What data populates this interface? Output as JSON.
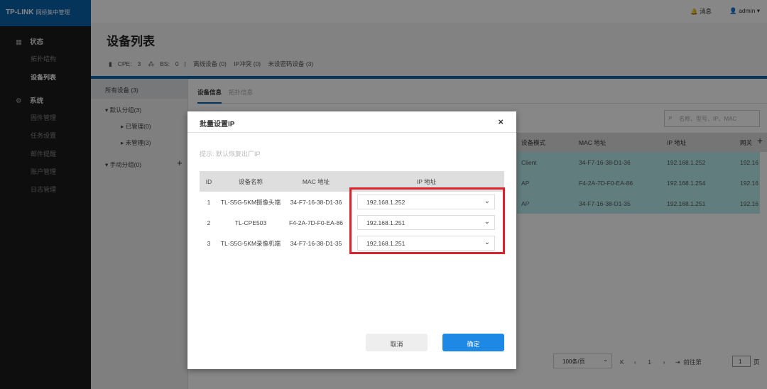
{
  "brand": {
    "logo": "TP-LINK",
    "product": "网桥集中管理"
  },
  "topbar": {
    "messages": "消息",
    "user": "admin"
  },
  "sidebar": {
    "sections": [
      {
        "label": "状态",
        "items": [
          "拓扑结构",
          "设备列表"
        ]
      },
      {
        "label": "系统",
        "items": [
          "固件管理",
          "任务设置",
          "邮件提醒",
          "账户管理",
          "日志管理"
        ]
      }
    ],
    "active": "设备列表"
  },
  "page": {
    "title": "设备列表",
    "stats": {
      "cpe_label": "CPE:",
      "cpe": "3",
      "bs_label": "BS:",
      "bs": "0",
      "offline": "离线设备 (0)",
      "ipconflict": "IP冲突 (0)",
      "nopassword": "未设密码设备 (3)"
    }
  },
  "groups": {
    "all": "所有设备 (3)",
    "default": "默认分组(3)",
    "managed": "已管理(0)",
    "unmanaged": "未管理(3)",
    "manual": "手动分组(0)"
  },
  "tabs": [
    "设备信息",
    "拓扑信息"
  ],
  "search": {
    "placeholder": "名称、型号、IP、MAC"
  },
  "bg_table": {
    "headers": [
      "设备模式",
      "MAC 地址",
      "IP 地址",
      "网关"
    ],
    "rows": [
      [
        "Client",
        "34-F7-16-38-D1-36",
        "192.168.1.252",
        "192.16"
      ],
      [
        "AP",
        "F4-2A-7D-F0-EA-86",
        "192.168.1.254",
        "192.16"
      ],
      [
        "AP",
        "34-F7-16-38-D1-35",
        "192.168.1.251",
        "192.16"
      ]
    ]
  },
  "pager": {
    "page_size": "100条/页",
    "current": "1",
    "goto_label": "前往第",
    "goto_value": "1",
    "page_suffix": "页"
  },
  "modal": {
    "title": "批量设置IP",
    "hint": "提示: 默认恢复出厂IP",
    "headers": [
      "ID",
      "设备名称",
      "MAC 地址",
      "IP 地址"
    ],
    "rows": [
      {
        "id": "1",
        "name": "TL-S5G-5KM摄像头端",
        "mac": "34-F7-16-38-D1-36",
        "ip": "192.168.1.252"
      },
      {
        "id": "2",
        "name": "TL-CPE503",
        "mac": "F4-2A-7D-F0-EA-86",
        "ip": "192.168.1.251"
      },
      {
        "id": "3",
        "name": "TL-S5G-5KM录像机端",
        "mac": "34-F7-16-38-D1-35",
        "ip": "192.168.1.251"
      }
    ],
    "cancel": "取消",
    "ok": "确定"
  },
  "colors": {
    "brand": "#0b62ad",
    "primary_button": "#1e88e5",
    "highlight_box": "#d9232d",
    "selected_row": "#b8ecef"
  }
}
